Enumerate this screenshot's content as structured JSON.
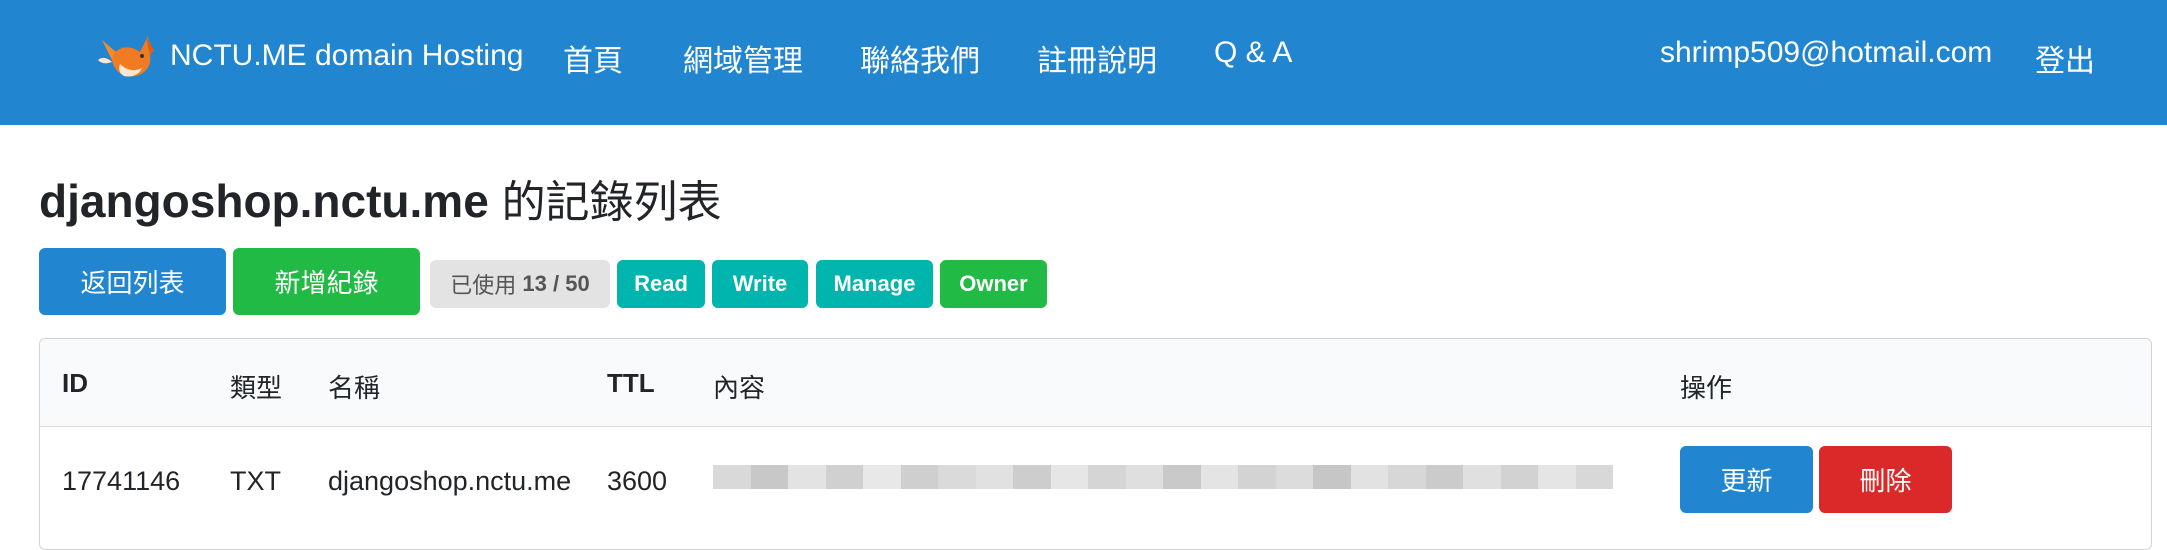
{
  "navbar": {
    "brand": "NCTU.ME domain Hosting",
    "links": [
      "首頁",
      "網域管理",
      "聯絡我們",
      "註冊說明",
      "Q & A"
    ],
    "user_email": "shrimp509@hotmail.com",
    "logout": "登出",
    "bg_color": "#2185d0"
  },
  "page": {
    "domain": "djangoshop.nctu.me",
    "title_suffix": "的記錄列表"
  },
  "toolbar": {
    "back_label": "返回列表",
    "add_label": "新增紀錄",
    "usage_prefix": "已使用",
    "usage_value": "13 / 50",
    "permissions": [
      "Read",
      "Write",
      "Manage",
      "Owner"
    ]
  },
  "table": {
    "headers": [
      "ID",
      "類型",
      "名稱",
      "TTL",
      "內容",
      "操作"
    ],
    "rows": [
      {
        "id": "17741146",
        "type": "TXT",
        "name": "djangoshop.nctu.me",
        "ttl": "3600",
        "update_label": "更新",
        "delete_label": "刪除"
      }
    ]
  },
  "colors": {
    "primary": "#2185d0",
    "success": "#21ba45",
    "teal": "#00b5ad",
    "danger": "#db2828"
  }
}
